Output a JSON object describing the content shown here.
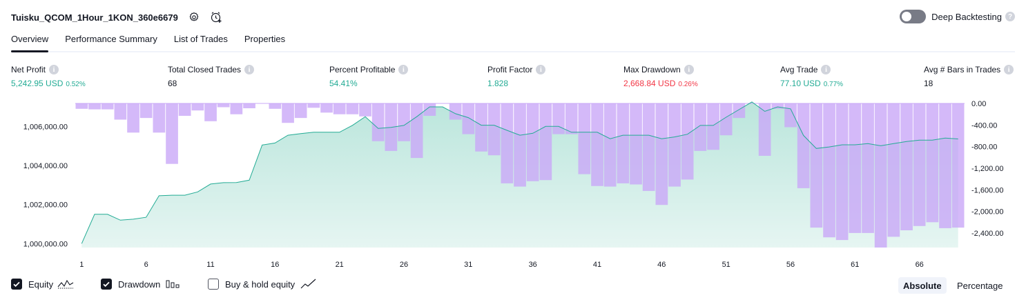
{
  "header": {
    "title": "Tuisku_QCOM_1Hour_1KON_360e6679",
    "settings_icon": "gear-icon",
    "add_alert_icon": "clock-plus-icon"
  },
  "deep_backtesting": {
    "label": "Deep Backtesting",
    "enabled": false,
    "help": "?"
  },
  "tabs": [
    {
      "label": "Overview",
      "active": true
    },
    {
      "label": "Performance Summary",
      "active": false
    },
    {
      "label": "List of Trades",
      "active": false
    },
    {
      "label": "Properties",
      "active": false
    }
  ],
  "metrics": {
    "net_profit": {
      "label": "Net Profit",
      "value": "5,242.95 USD",
      "pct": "0.52%"
    },
    "total_closed_trades": {
      "label": "Total Closed Trades",
      "value": "68"
    },
    "percent_profitable": {
      "label": "Percent Profitable",
      "value": "54.41%"
    },
    "profit_factor": {
      "label": "Profit Factor",
      "value": "1.828"
    },
    "max_drawdown": {
      "label": "Max Drawdown",
      "value": "2,668.84 USD",
      "pct": "0.26%"
    },
    "avg_trade": {
      "label": "Avg Trade",
      "value": "77.10 USD",
      "pct": "0.77%"
    },
    "avg_bars": {
      "label": "Avg # Bars in Trades",
      "value": "18"
    },
    "info_glyph": "i"
  },
  "colors": {
    "positive": "#22ab94",
    "negative": "#f23645",
    "drawdown_bar": "#c9a8f7",
    "equity_line": "#22ab94",
    "equity_fill": "#b7e4da"
  },
  "chart_data": {
    "type": "area",
    "x": [
      1,
      2,
      3,
      4,
      5,
      6,
      7,
      8,
      9,
      10,
      11,
      12,
      13,
      14,
      15,
      16,
      17,
      18,
      19,
      20,
      21,
      22,
      23,
      24,
      25,
      26,
      27,
      28,
      29,
      30,
      31,
      32,
      33,
      34,
      35,
      36,
      37,
      38,
      39,
      40,
      41,
      42,
      43,
      44,
      45,
      46,
      47,
      48,
      49,
      50,
      51,
      52,
      53,
      54,
      55,
      56,
      57,
      58,
      59,
      60,
      61,
      62,
      63,
      64,
      65,
      66,
      67,
      68,
      69
    ],
    "xticks": [
      "1",
      "6",
      "11",
      "16",
      "21",
      "26",
      "31",
      "36",
      "41",
      "46",
      "51",
      "56",
      "61",
      "66"
    ],
    "y_left_ticks": [
      "1,000,000.00",
      "1,002,000.00",
      "1,004,000.00",
      "1,006,000.00"
    ],
    "y_left_lim": [
      999800,
      1007600
    ],
    "y_right_ticks": [
      "0.00",
      "-400.00",
      "-800.00",
      "-1,200.00",
      "-1,600.00",
      "-2,000.00",
      "-2,400.00"
    ],
    "y_right_lim": [
      -2668.84,
      0
    ],
    "series": [
      {
        "name": "Equity",
        "values": [
          1000000,
          1001500,
          1001500,
          1001200,
          1001250,
          1001350,
          1002450,
          1002480,
          1002480,
          1002650,
          1003050,
          1003120,
          1003130,
          1003250,
          1005050,
          1005150,
          1005550,
          1005630,
          1005700,
          1005700,
          1005700,
          1006050,
          1006500,
          1005900,
          1005950,
          1006050,
          1006500,
          1007000,
          1007000,
          1006650,
          1006450,
          1006060,
          1006060,
          1005800,
          1005550,
          1005650,
          1006000,
          1006000,
          1005700,
          1005700,
          1005700,
          1005370,
          1005550,
          1005550,
          1005550,
          1005370,
          1005460,
          1005600,
          1006050,
          1006050,
          1006470,
          1006860,
          1007250,
          1006770,
          1007000,
          1006900,
          1005540,
          1004870,
          1004950,
          1005060,
          1005060,
          1005120,
          1005010,
          1005120,
          1005230,
          1005300,
          1005300,
          1005400,
          1005360
        ]
      },
      {
        "name": "Drawdown",
        "values": [
          -100,
          -110,
          -110,
          -300,
          -540,
          -270,
          -540,
          -1120,
          -230,
          -130,
          -330,
          -70,
          -200,
          -90,
          0,
          -100,
          -360,
          -270,
          -80,
          -170,
          -200,
          -200,
          -240,
          -700,
          -880,
          -700,
          -1010,
          -230,
          0,
          -300,
          -570,
          -890,
          -960,
          -1480,
          -1540,
          -1440,
          -1420,
          -570,
          -570,
          -1310,
          -1530,
          -1540,
          -1480,
          -1500,
          -1620,
          -1880,
          -1540,
          -1410,
          -880,
          -860,
          -590,
          -270,
          0,
          -970,
          -100,
          -440,
          -1570,
          -2300,
          -2480,
          -2530,
          -2400,
          -2400,
          -2668.84,
          -2470,
          -2350,
          -2270,
          -2200,
          -2310,
          -2300
        ]
      }
    ],
    "grid": false
  },
  "legend": {
    "equity": {
      "label": "Equity",
      "checked": true,
      "icon": "equity-line-icon"
    },
    "drawdown": {
      "label": "Drawdown",
      "checked": true,
      "icon": "drawdown-bars-icon"
    },
    "buy_hold": {
      "label": "Buy & hold equity",
      "checked": false,
      "icon": "buy-hold-line-icon"
    }
  },
  "view_modes": [
    {
      "label": "Absolute",
      "active": true
    },
    {
      "label": "Percentage",
      "active": false
    }
  ]
}
